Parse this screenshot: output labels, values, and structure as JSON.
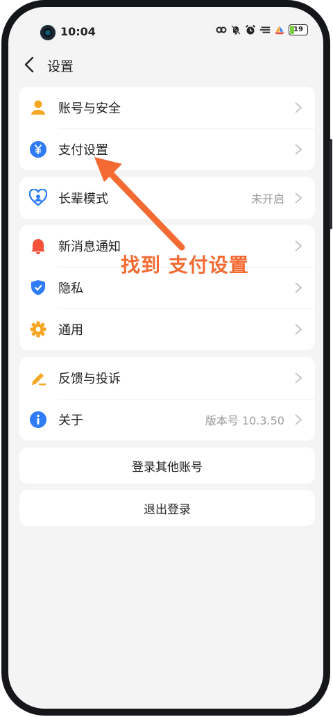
{
  "status_bar": {
    "time": "10:04",
    "battery": "19",
    "icons": [
      "link-icon",
      "mute-bell-icon",
      "alarm-icon",
      "signal-icon",
      "boat-icon"
    ]
  },
  "header": {
    "back_icon": "chevron-left-icon",
    "title": "设置"
  },
  "groups": [
    {
      "items": [
        {
          "icon": "person-icon",
          "label": "账号与安全",
          "value": ""
        },
        {
          "icon": "yuan-icon",
          "label": "支付设置",
          "value": ""
        }
      ]
    },
    {
      "items": [
        {
          "icon": "heart-person-icon",
          "label": "长辈模式",
          "value": "未开启"
        }
      ]
    },
    {
      "items": [
        {
          "icon": "bell-icon",
          "label": "新消息通知",
          "value": ""
        },
        {
          "icon": "shield-icon",
          "label": "隐私",
          "value": ""
        },
        {
          "icon": "gear-icon",
          "label": "通用",
          "value": ""
        }
      ]
    },
    {
      "items": [
        {
          "icon": "pen-icon",
          "label": "反馈与投诉",
          "value": ""
        },
        {
          "icon": "info-icon",
          "label": "关于",
          "value": "版本号 10.3.50"
        }
      ]
    }
  ],
  "buttons": {
    "switch_account": "登录其他账号",
    "logout": "退出登录"
  },
  "annotation": {
    "text": "找到 支付设置",
    "color": "#f46a33"
  },
  "colors": {
    "orange": "#f5a623",
    "blue": "#2f7cf6",
    "red": "#f4523b",
    "background": "#f4f4f4"
  }
}
